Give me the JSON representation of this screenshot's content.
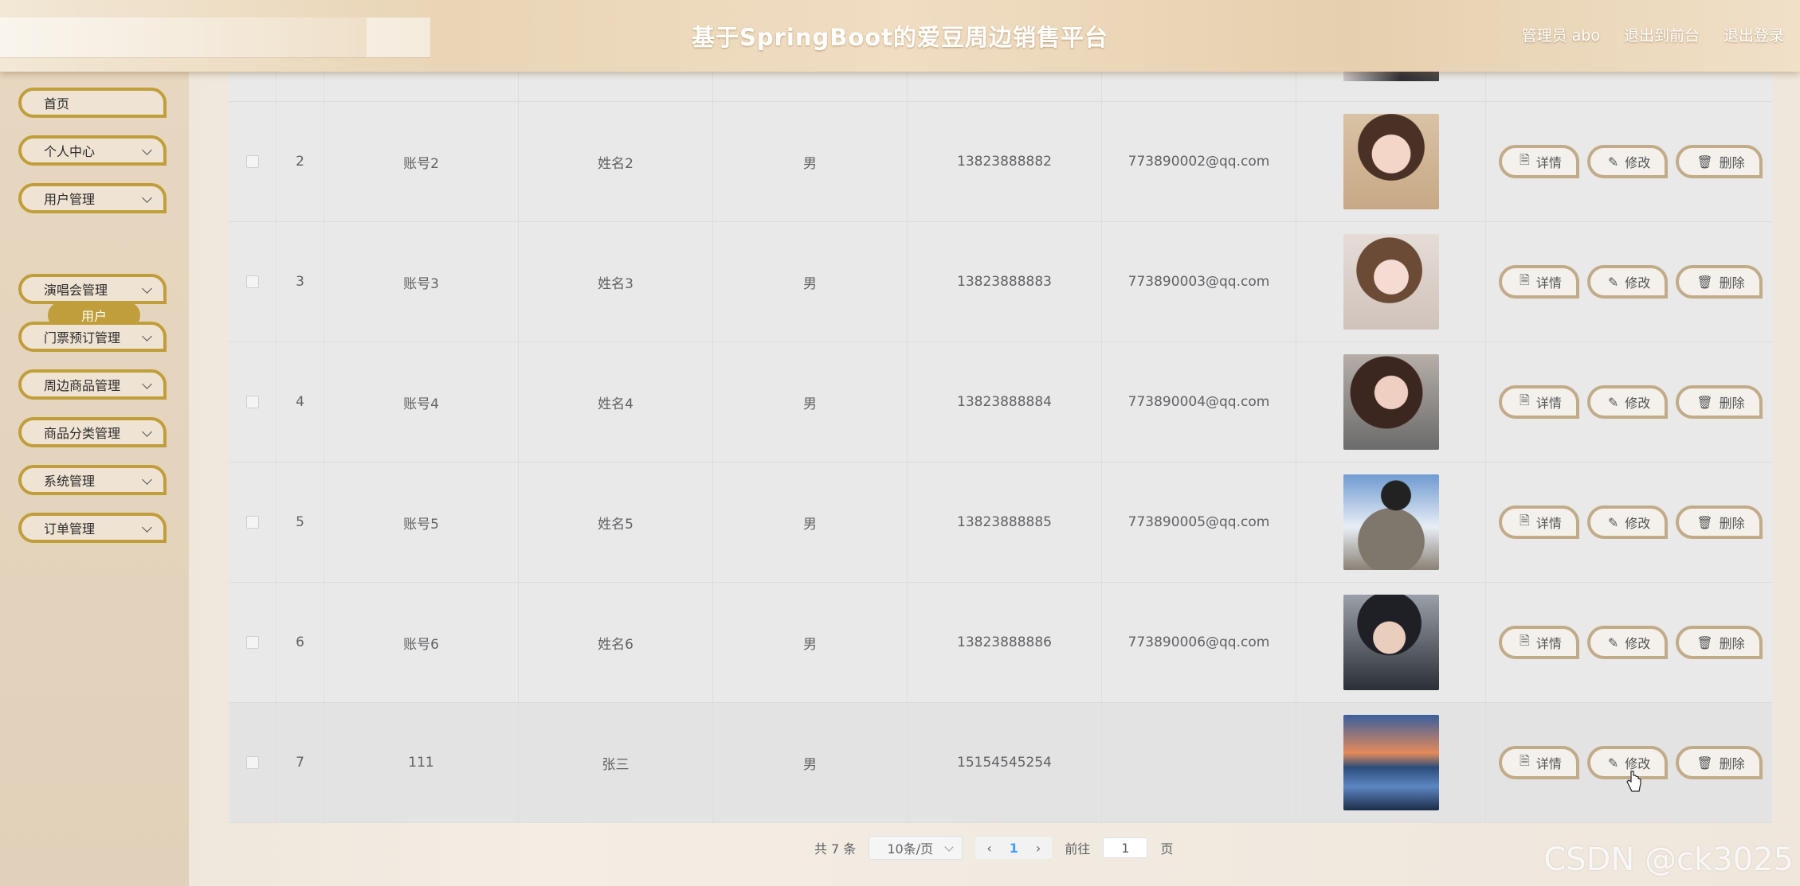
{
  "header": {
    "title": "基于SpringBoot的爱豆周边销售平台",
    "admin_label": "管理员 abo",
    "back_front": "退出到前台",
    "logout": "退出登录"
  },
  "sidebar": {
    "items": [
      {
        "label": "首页",
        "has_chevron": false
      },
      {
        "label": "个人中心",
        "has_chevron": true
      },
      {
        "label": "用户管理",
        "has_chevron": true
      },
      {
        "label": "演唱会管理",
        "has_chevron": true
      },
      {
        "label": "门票预订管理",
        "has_chevron": true
      },
      {
        "label": "周边商品管理",
        "has_chevron": true
      },
      {
        "label": "商品分类管理",
        "has_chevron": true
      },
      {
        "label": "系统管理",
        "has_chevron": true
      },
      {
        "label": "订单管理",
        "has_chevron": true
      }
    ],
    "active_sub": "用户"
  },
  "ops": {
    "detail": "详情",
    "edit": "修改",
    "delete": "删除"
  },
  "rows": [
    {
      "idx": "2",
      "account": "账号2",
      "name": "姓名2",
      "sex": "男",
      "phone": "13823888882",
      "email": "773890002@qq.com"
    },
    {
      "idx": "3",
      "account": "账号3",
      "name": "姓名3",
      "sex": "男",
      "phone": "13823888883",
      "email": "773890003@qq.com"
    },
    {
      "idx": "4",
      "account": "账号4",
      "name": "姓名4",
      "sex": "男",
      "phone": "13823888884",
      "email": "773890004@qq.com"
    },
    {
      "idx": "5",
      "account": "账号5",
      "name": "姓名5",
      "sex": "男",
      "phone": "13823888885",
      "email": "773890005@qq.com"
    },
    {
      "idx": "6",
      "account": "账号6",
      "name": "姓名6",
      "sex": "男",
      "phone": "13823888886",
      "email": "773890006@qq.com"
    },
    {
      "idx": "7",
      "account": "111",
      "name": "张三",
      "sex": "男",
      "phone": "15154545254",
      "email": ""
    }
  ],
  "pagination": {
    "total": "共 7 条",
    "page_size": "10条/页",
    "current_page": "1",
    "goto_label": "前往",
    "goto_value": "1",
    "page_unit": "页"
  },
  "watermark": "CSDN @ck3025"
}
